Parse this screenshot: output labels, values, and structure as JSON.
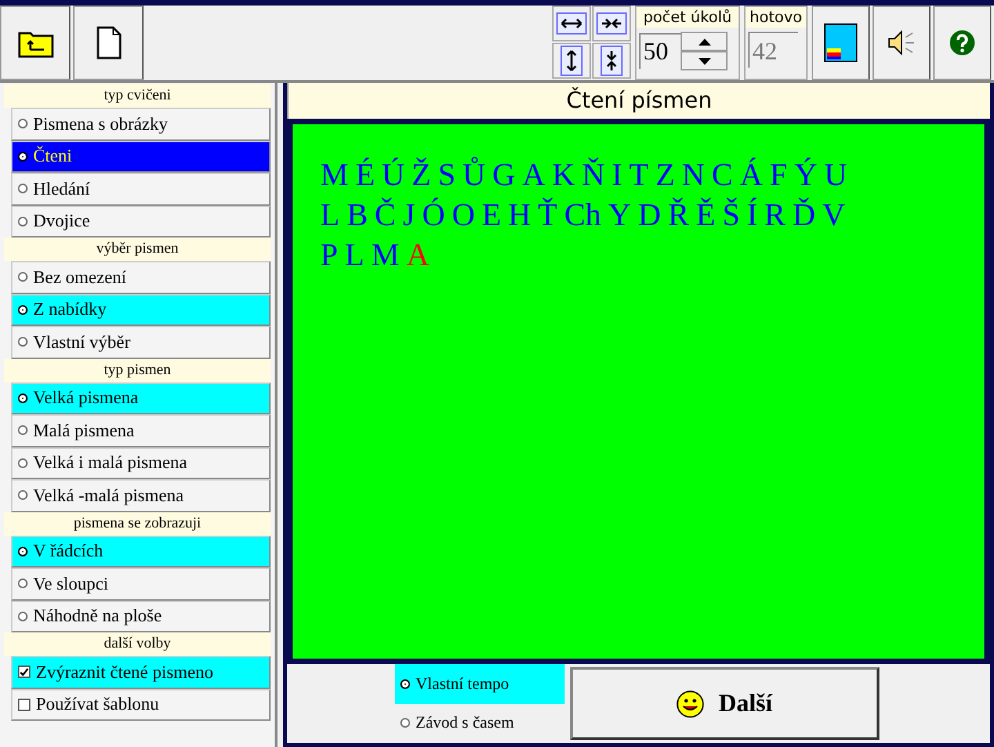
{
  "toolbar": {
    "task_count": {
      "label": "počet úkolů",
      "value": "50"
    },
    "done": {
      "label": "hotovo",
      "value": "42"
    }
  },
  "sidebar": {
    "groups": [
      {
        "title": "typ cvičeni",
        "kind": "radio",
        "items": [
          {
            "label": "Pismena s obrázky",
            "selected": false,
            "focused": false
          },
          {
            "label": "Čteni",
            "selected": true,
            "focused": true
          },
          {
            "label": "Hledání",
            "selected": false,
            "focused": false
          },
          {
            "label": "Dvojice",
            "selected": false,
            "focused": false
          }
        ]
      },
      {
        "title": "výběr pismen",
        "kind": "radio",
        "items": [
          {
            "label": "Bez omezení",
            "selected": false,
            "focused": false
          },
          {
            "label": "Z nabídky",
            "selected": true,
            "focused": false
          },
          {
            "label": "Vlastní výběr",
            "selected": false,
            "focused": false
          }
        ]
      },
      {
        "title": "typ pismen",
        "kind": "radio",
        "items": [
          {
            "label": "Velká pismena",
            "selected": true,
            "focused": false
          },
          {
            "label": "Malá pismena",
            "selected": false,
            "focused": false
          },
          {
            "label": "Velká i malá pismena",
            "selected": false,
            "focused": false
          },
          {
            "label": "Velká -malá pismena",
            "selected": false,
            "focused": false
          }
        ]
      },
      {
        "title": "pismena se zobrazuji",
        "kind": "radio",
        "items": [
          {
            "label": "V řádcích",
            "selected": true,
            "focused": false
          },
          {
            "label": "Ve sloupci",
            "selected": false,
            "focused": false
          },
          {
            "label": "Náhodně na ploše",
            "selected": false,
            "focused": false
          }
        ]
      },
      {
        "title": "další volby",
        "kind": "checkbox",
        "items": [
          {
            "label": "Zvýraznit čtené pismeno",
            "selected": true,
            "focused": false
          },
          {
            "label": "Používat šablonu",
            "selected": false,
            "focused": false
          }
        ]
      }
    ]
  },
  "main": {
    "title": "Čtení písmen",
    "letter_rows": [
      [
        {
          "text": "M",
          "current": false
        },
        {
          "text": "É",
          "current": false
        },
        {
          "text": "Ú",
          "current": false
        },
        {
          "text": "Ž",
          "current": false
        },
        {
          "text": "S",
          "current": false
        },
        {
          "text": "Ů",
          "current": false
        },
        {
          "text": "G",
          "current": false
        },
        {
          "text": "A",
          "current": false
        },
        {
          "text": "K",
          "current": false
        },
        {
          "text": "Ň",
          "current": false
        },
        {
          "text": "I",
          "current": false
        },
        {
          "text": "T",
          "current": false
        },
        {
          "text": "Z",
          "current": false
        },
        {
          "text": "N",
          "current": false
        },
        {
          "text": "C",
          "current": false
        },
        {
          "text": "Á",
          "current": false
        },
        {
          "text": "F",
          "current": false
        },
        {
          "text": "Ý",
          "current": false
        },
        {
          "text": "U",
          "current": false
        }
      ],
      [
        {
          "text": "L",
          "current": false
        },
        {
          "text": "B",
          "current": false
        },
        {
          "text": "Č",
          "current": false
        },
        {
          "text": "J",
          "current": false
        },
        {
          "text": "Ó",
          "current": false
        },
        {
          "text": "O",
          "current": false
        },
        {
          "text": "E",
          "current": false
        },
        {
          "text": "H",
          "current": false
        },
        {
          "text": "Ť",
          "current": false
        },
        {
          "text": "Ch",
          "current": false
        },
        {
          "text": "Y",
          "current": false
        },
        {
          "text": "D",
          "current": false
        },
        {
          "text": "Ř",
          "current": false
        },
        {
          "text": "Ě",
          "current": false
        },
        {
          "text": "Š",
          "current": false
        },
        {
          "text": "Í",
          "current": false
        },
        {
          "text": "R",
          "current": false
        },
        {
          "text": "Ď",
          "current": false
        },
        {
          "text": "V",
          "current": false
        }
      ],
      [
        {
          "text": "P",
          "current": false
        },
        {
          "text": "L",
          "current": false
        },
        {
          "text": "M",
          "current": false
        },
        {
          "text": "A",
          "current": true
        }
      ]
    ],
    "modes": [
      {
        "label": "Vlastní tempo",
        "selected": true
      },
      {
        "label": "Závod s časem",
        "selected": false
      }
    ],
    "next_button": "Další"
  }
}
